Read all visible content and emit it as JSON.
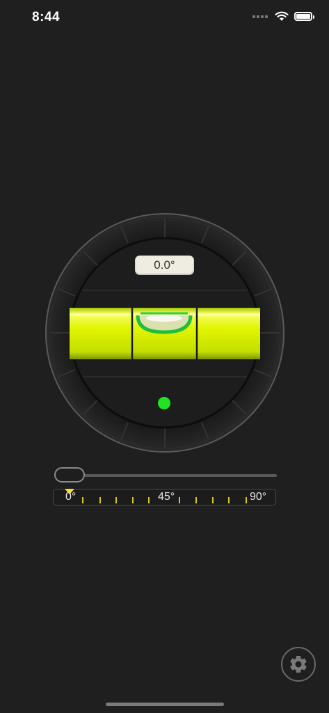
{
  "status_bar": {
    "time": "8:44"
  },
  "level": {
    "angle_readout": "0.0°",
    "bubble_color": "#22e322",
    "vial_color": "#d8f000"
  },
  "scale": {
    "labels": [
      "0°",
      "45°",
      "90°"
    ]
  },
  "slider": {
    "value_fraction": 0.0
  },
  "icons": {
    "settings": "gear-icon",
    "wifi": "wifi-icon",
    "battery": "battery-icon",
    "signal": "signal-icon"
  }
}
